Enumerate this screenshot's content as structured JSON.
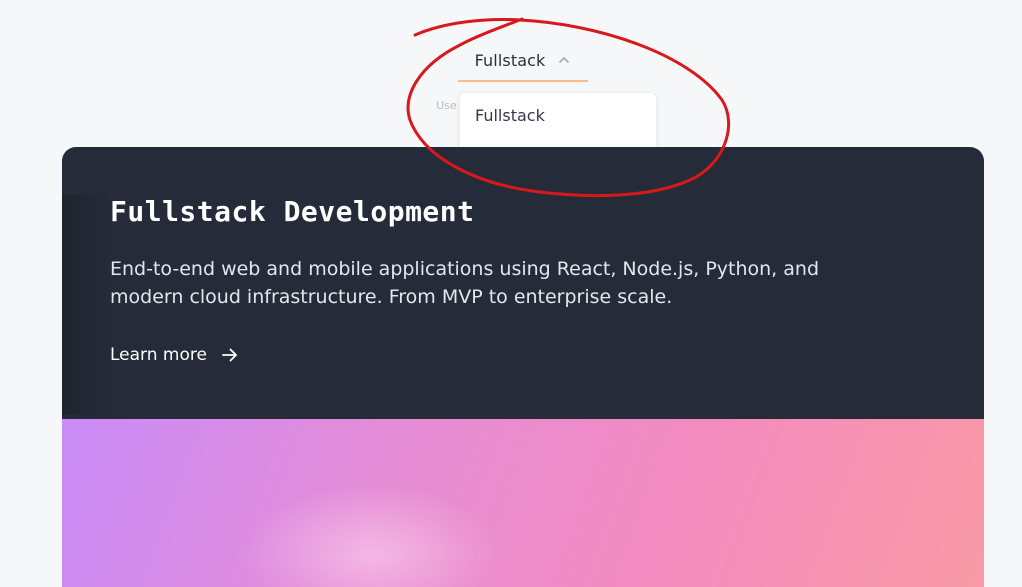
{
  "selector": {
    "label": "Fullstack",
    "hint": "Use arrow keys to navigate",
    "options": [
      "Fullstack"
    ]
  },
  "card": {
    "title": "Fullstack Development",
    "description": "End-to-end web and mobile applications using React, Node.js, Python, and modern cloud infrastructure. From MVP to enterprise scale.",
    "cta": "Learn more"
  },
  "colors": {
    "page_background": "#f6f7f9",
    "card_background": "#262b39",
    "selector_underline": "#f8bd8a",
    "annotation_stroke": "#d7191c",
    "gradient_start": "#c98cf8",
    "gradient_end": "#f99aa6"
  },
  "icons": {
    "selector_chevron": "chevron-up-icon",
    "cta_arrow": "arrow-right-icon"
  }
}
